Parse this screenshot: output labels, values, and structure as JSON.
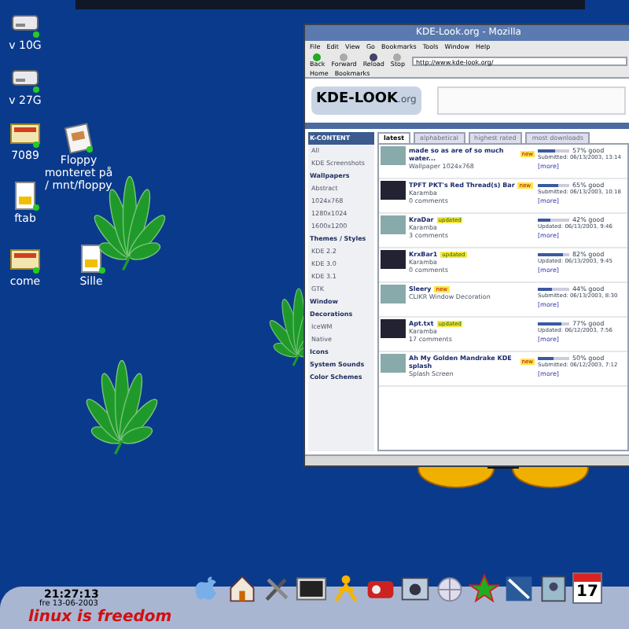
{
  "desktop_icons": [
    {
      "label": "v 10G",
      "kind": "drive"
    },
    {
      "label": "v 27G",
      "kind": "drive"
    },
    {
      "label": "7089",
      "kind": "folder"
    },
    {
      "label": "Floppy monteret på / mnt/floppy",
      "kind": "floppy"
    },
    {
      "label": "ftab",
      "kind": "document"
    },
    {
      "label": "come",
      "kind": "folder"
    },
    {
      "label": "Sille",
      "kind": "document"
    }
  ],
  "browser": {
    "title": "KDE-Look.org - Mozilla",
    "menu": [
      "File",
      "Edit",
      "View",
      "Go",
      "Bookmarks",
      "Tools",
      "Window",
      "Help"
    ],
    "toolbar": [
      "Back",
      "Forward",
      "Reload",
      "Stop"
    ],
    "url": "http://www.kde-look.org/",
    "bookmarks": [
      "Home",
      "Bookmarks"
    ],
    "logo": "KDE-LOOK",
    "logo_suffix": ".org",
    "sidebar": [
      {
        "label": "K-CONTENT",
        "kind": "header"
      },
      {
        "label": "All",
        "kind": "item"
      },
      {
        "label": "KDE Screenshots",
        "kind": "item"
      },
      {
        "label": "Wallpapers",
        "kind": "section"
      },
      {
        "label": "Abstract",
        "kind": "item"
      },
      {
        "label": "1024x768",
        "kind": "item"
      },
      {
        "label": "1280x1024",
        "kind": "item"
      },
      {
        "label": "1600x1200",
        "kind": "item"
      },
      {
        "label": "Themes / Styles",
        "kind": "section"
      },
      {
        "label": "KDE 2.2",
        "kind": "item"
      },
      {
        "label": "KDE 3.0",
        "kind": "item"
      },
      {
        "label": "KDE 3.1",
        "kind": "item"
      },
      {
        "label": "GTK",
        "kind": "item"
      },
      {
        "label": "Window Decorations",
        "kind": "section"
      },
      {
        "label": "IceWM",
        "kind": "item"
      },
      {
        "label": "Native",
        "kind": "item"
      },
      {
        "label": "Icons",
        "kind": "section"
      },
      {
        "label": "System Sounds",
        "kind": "section"
      },
      {
        "label": "Color Schemes",
        "kind": "section"
      }
    ],
    "tabs": [
      {
        "label": "latest",
        "selected": true
      },
      {
        "label": "alphabetical",
        "selected": false
      },
      {
        "label": "highest rated",
        "selected": false
      },
      {
        "label": "most downloads",
        "selected": false
      }
    ],
    "entries": [
      {
        "title": "made so as are of so much water...",
        "badge": "new",
        "category": "Wallpaper 1024x768",
        "score": "57% good",
        "level": 0.57,
        "date": "Submitted: 06/13/2003, 13:14",
        "more": "[more]"
      },
      {
        "title": "TPFT PKT's Red Thread(s) Bar",
        "badge": "new",
        "category": "Karamba",
        "comments": "0 comments",
        "score": "65% good",
        "level": 0.65,
        "date": "Submitted: 06/13/2003, 10:18",
        "more": "[more]"
      },
      {
        "title": "KraDar",
        "badge": "updated",
        "category": "Karamba",
        "comments": "3 comments",
        "score": "42% good",
        "level": 0.42,
        "date": "Updated: 06/13/2003, 9:46",
        "more": "[more]"
      },
      {
        "title": "KrxBar1",
        "badge": "updated",
        "category": "Karamba",
        "comments": "0 comments",
        "score": "82% good",
        "level": 0.82,
        "date": "Updated: 06/13/2003, 9:45",
        "more": "[more]"
      },
      {
        "title": "Sleery",
        "badge": "new",
        "category": "CLIKR Window Decoration",
        "score": "44% good",
        "level": 0.44,
        "date": "Submitted: 06/13/2003, 8:30",
        "more": "[more]"
      },
      {
        "title": "Apt.txt",
        "badge": "updated",
        "category": "Karamba",
        "comments": "17 comments",
        "score": "77% good",
        "level": 0.77,
        "date": "Updated: 06/12/2003, 7:56",
        "more": "[more]"
      },
      {
        "title": "Ah My Golden Mandrake KDE splash",
        "badge": "new",
        "category": "Splash Screen",
        "score": "50% good",
        "level": 0.5,
        "date": "Submitted: 06/12/2003, 7:12",
        "more": "[more]"
      }
    ]
  },
  "panel": {
    "time": "21:27:13",
    "date": "fre 13-06-2003",
    "slogan": "linux is freedom",
    "launchers": [
      {
        "kind": "apple"
      },
      {
        "kind": "home"
      },
      {
        "kind": "tools"
      },
      {
        "kind": "terminal"
      },
      {
        "kind": "person"
      },
      {
        "kind": "media"
      },
      {
        "kind": "camera"
      },
      {
        "kind": "globe"
      },
      {
        "kind": "star"
      },
      {
        "kind": "pen"
      },
      {
        "kind": "photo"
      },
      {
        "kind": "calendar",
        "day": "17"
      }
    ]
  }
}
